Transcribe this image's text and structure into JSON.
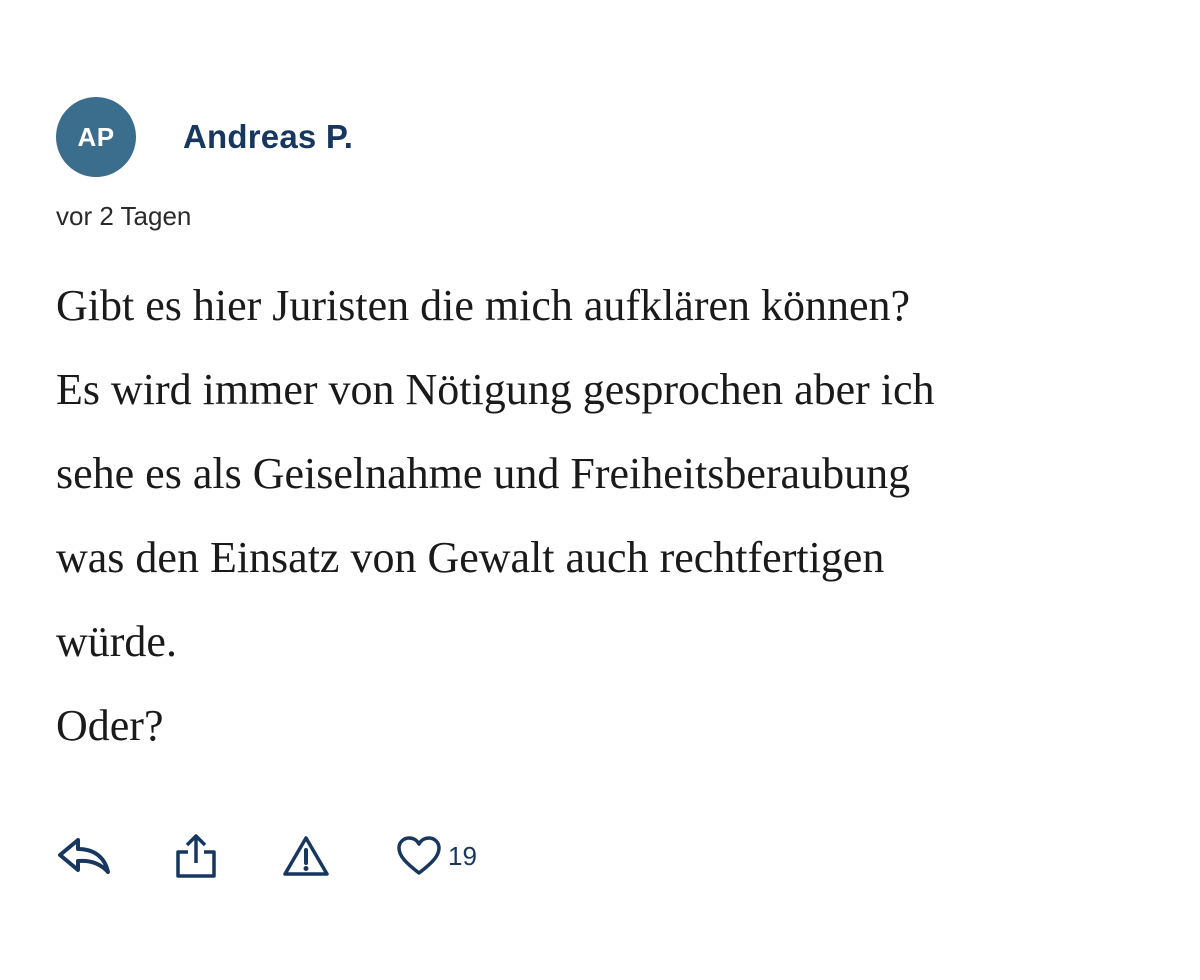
{
  "comment": {
    "avatar_initials": "AP",
    "author": "Andreas P.",
    "timestamp": "vor 2 Tagen",
    "lines": [
      "Gibt es hier Juristen die mich aufklären können?",
      "Es wird immer von Nötigung gesprochen aber ich",
      "sehe es als Geiselnahme und Freiheitsberaubung",
      "was den Einsatz von Gewalt auch rechtfertigen",
      "würde.",
      "Oder?"
    ]
  },
  "actions": {
    "reply_icon": "reply-icon",
    "share_icon": "share-icon",
    "report_icon": "warning-icon",
    "like_icon": "heart-icon",
    "like_count": "19"
  },
  "colors": {
    "avatar_bg": "#3b6e8c",
    "author": "#17375e",
    "icon": "#17375e"
  }
}
